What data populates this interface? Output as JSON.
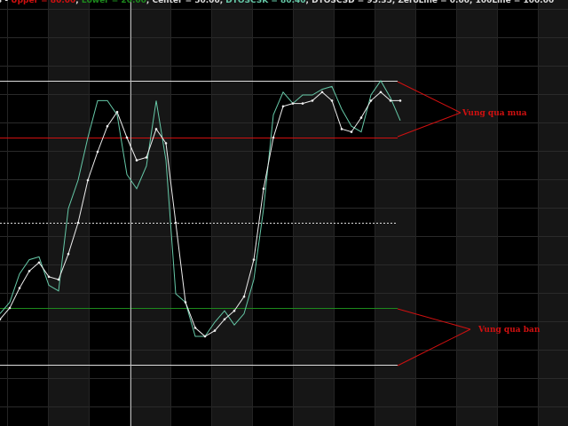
{
  "chart_data": {
    "type": "line",
    "title": "",
    "xlabel": "",
    "ylabel": "",
    "ylim": [
      0,
      100
    ],
    "grid": true,
    "legend": {
      "placement": "top-left",
      "entries": [
        {
          "text": "Upper = 80.00",
          "color": "#d01010"
        },
        {
          "text": "Lower = 20.00",
          "color": "#1d8a1d"
        },
        {
          "text": "Center = 50.00",
          "color": "#dddddd"
        },
        {
          "text": "DTOSCSK = 80.40",
          "color": "#66c9a8"
        },
        {
          "text": "DTOSCSD = 95.35",
          "color": "#dddddd"
        },
        {
          "text": "ZeroLine = 0.00",
          "color": "#dddddd"
        },
        {
          "text": "100Line = 100.00",
          "color": "#dddddd"
        }
      ]
    },
    "levels": [
      {
        "name": "100Line",
        "value": 100,
        "color": "#dddddd"
      },
      {
        "name": "Upper",
        "value": 80,
        "color": "#d01010"
      },
      {
        "name": "Center",
        "value": 50,
        "color": "#dddddd"
      },
      {
        "name": "Lower",
        "value": 20,
        "color": "#1d8a1d"
      },
      {
        "name": "ZeroLine",
        "value": 0,
        "color": "#dddddd"
      }
    ],
    "x": [
      0,
      1,
      2,
      3,
      4,
      5,
      6,
      7,
      8,
      9,
      10,
      11,
      12,
      13,
      14,
      15,
      16,
      17,
      18,
      19,
      20,
      21,
      22,
      23,
      24,
      25,
      26,
      27,
      28,
      29,
      30,
      31,
      32,
      33,
      34,
      35,
      36,
      37,
      38,
      39,
      40,
      41,
      42,
      43,
      44,
      45,
      46,
      47,
      48,
      49,
      50,
      51,
      52,
      53,
      54,
      55
    ],
    "series": [
      {
        "name": "DTOSCSK",
        "color": "#66c9a8",
        "values": [
          18,
          22,
          32,
          37,
          38,
          28,
          26,
          55,
          65,
          80,
          93,
          93,
          88,
          67,
          62,
          70,
          93,
          72,
          25,
          22,
          10,
          10,
          15,
          19,
          14,
          18,
          30,
          55,
          88,
          96,
          92,
          95,
          95,
          97,
          98,
          90,
          84,
          82,
          95,
          100,
          94,
          86
        ]
      },
      {
        "name": "DTOSCSD",
        "color": "#eeeeee",
        "values": [
          16,
          20,
          27,
          33,
          36,
          31,
          30,
          39,
          50,
          65,
          75,
          84,
          89,
          80,
          72,
          73,
          83,
          78,
          50,
          22,
          13,
          10,
          12,
          16,
          19,
          24,
          37,
          62,
          80,
          91,
          92,
          92,
          93,
          96,
          93,
          83,
          82,
          87,
          93,
          96,
          93,
          93
        ]
      }
    ],
    "annotations": [
      {
        "text": "Vung qua mua",
        "color": "#d01010"
      },
      {
        "text": "Vung qua ban",
        "color": "#d01010"
      }
    ]
  }
}
